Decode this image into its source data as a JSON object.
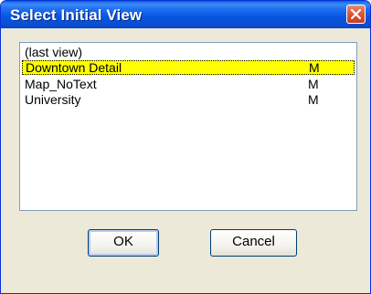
{
  "dialog": {
    "title": "Select Initial View",
    "close_icon": "close-icon"
  },
  "list": {
    "items": [
      {
        "name": "(last view)",
        "flag": ""
      },
      {
        "name": "Downtown Detail",
        "flag": "M",
        "selected": true
      },
      {
        "name": "Map_NoText",
        "flag": "M"
      },
      {
        "name": "University",
        "flag": "M"
      }
    ],
    "selected_color": "#ffff00"
  },
  "buttons": {
    "ok_label": "OK",
    "cancel_label": "Cancel"
  },
  "colors": {
    "titlebar": "#0554e2",
    "dialog_bg": "#ece9d8",
    "close_button": "#dc5b3c"
  }
}
